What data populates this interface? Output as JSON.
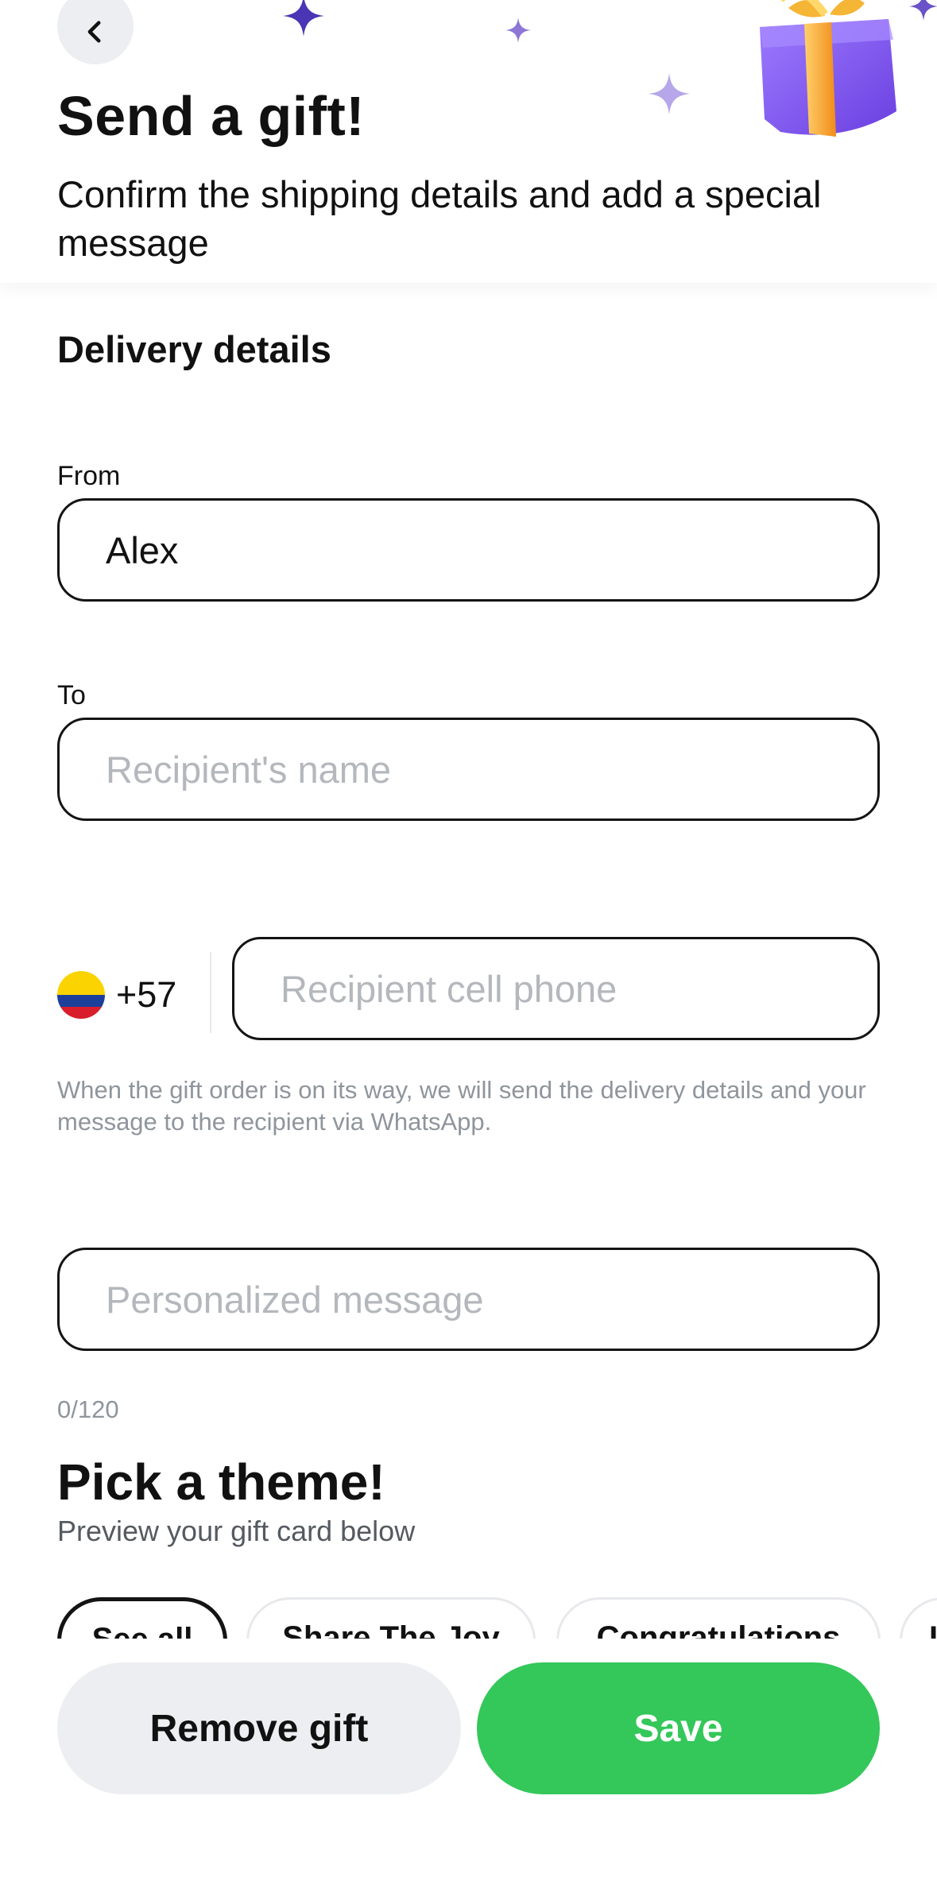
{
  "header": {
    "title": "Send a gift!",
    "subtitle": "Confirm the shipping details and add a special message"
  },
  "delivery": {
    "section_title": "Delivery details",
    "from_label": "From",
    "from_value": "Alex",
    "to_label": "To",
    "to_placeholder": "Recipient's name",
    "country_code": "+57",
    "phone_placeholder": "Recipient cell phone",
    "helper_text": "When the gift order is on its way, we will send the delivery details and your message to the recipient via WhatsApp.",
    "message_placeholder": "Personalized message",
    "message_counter": "0/120"
  },
  "theme": {
    "title": "Pick a theme!",
    "subtitle": "Preview your gift card below",
    "chips": [
      "See all",
      "Share The Joy",
      "Congratulations",
      "I"
    ]
  },
  "actions": {
    "remove_label": "Remove gift",
    "save_label": "Save"
  },
  "colors": {
    "primary_green": "#34c759",
    "secondary_gray": "#eceef1",
    "sparkle_purple": "#5b3fc4",
    "gift_purple": "#8b5cf6",
    "ribbon_orange": "#f5a524"
  },
  "icons": {
    "back": "chevron-left-icon",
    "flag": "colombia-flag-icon",
    "gift": "gift-box-icon",
    "sparkle": "sparkle-icon"
  }
}
